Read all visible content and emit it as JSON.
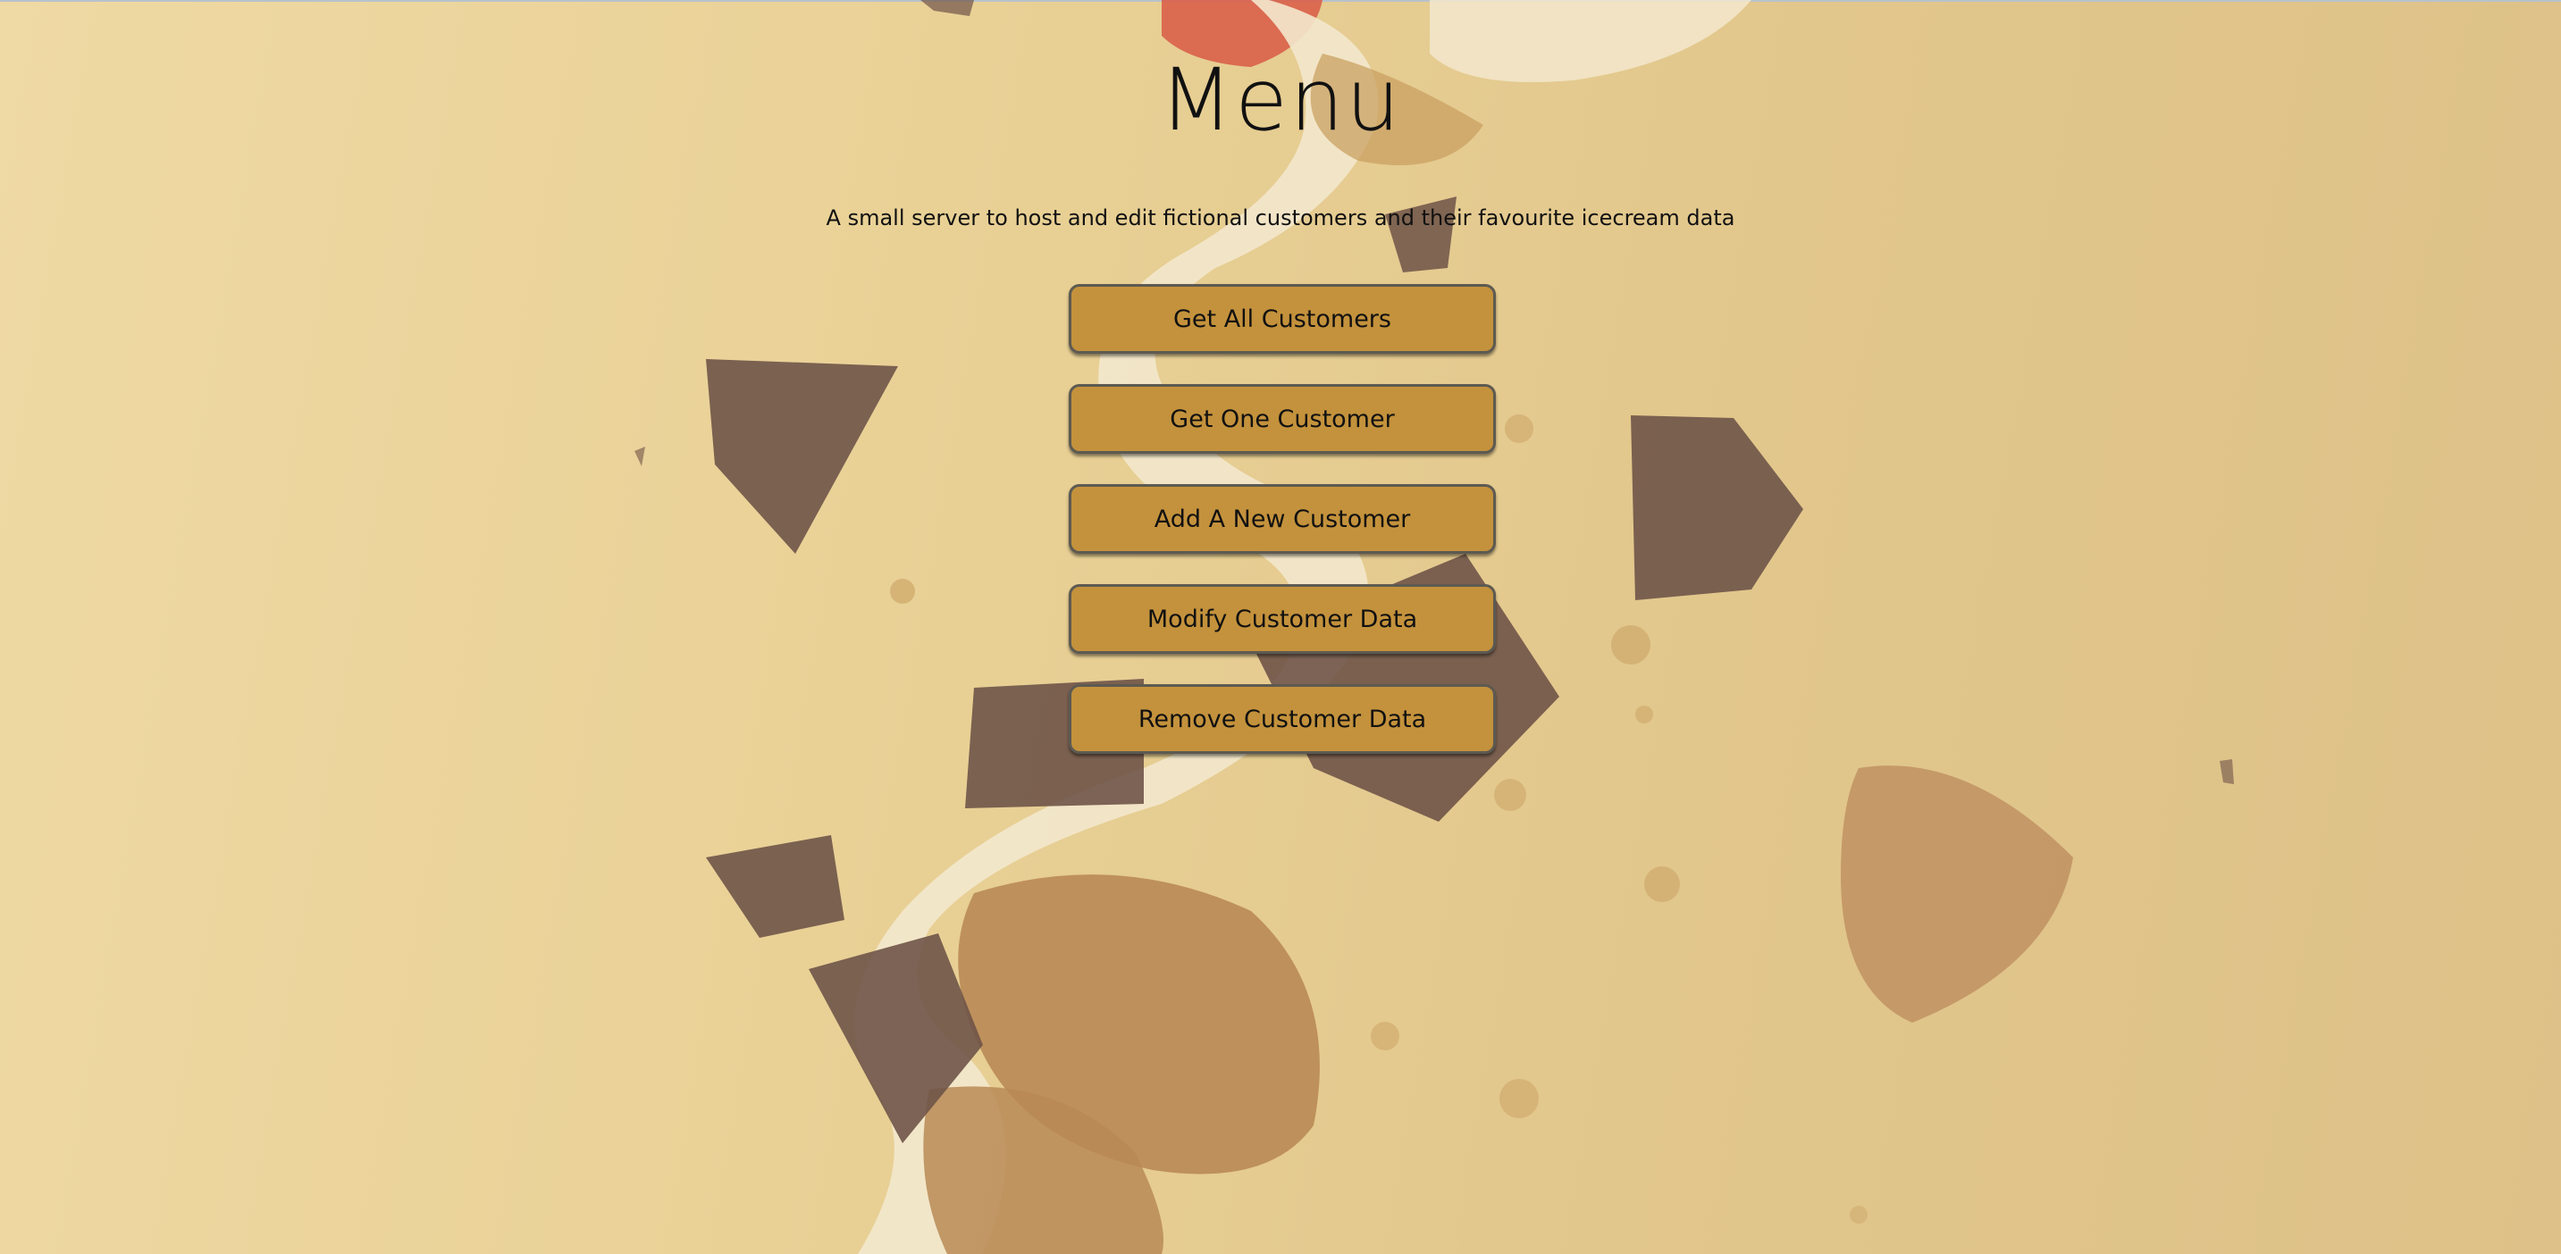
{
  "page": {
    "title": "Menu",
    "subtitle": "A small server to host and edit fictional customers and their favourite icecream data"
  },
  "menu": {
    "buttons": [
      {
        "label": "Get All Customers"
      },
      {
        "label": "Get One Customer"
      },
      {
        "label": "Add A New Customer"
      },
      {
        "label": "Modify Customer Data"
      },
      {
        "label": "Remove Customer Data"
      }
    ]
  },
  "colors": {
    "background": "#e9d196",
    "button_fill": "#c4923c",
    "button_border": "#5d5a52",
    "text": "#111111"
  },
  "background_image": {
    "icon": "ice-cream-cookie-chocolate-photo"
  }
}
